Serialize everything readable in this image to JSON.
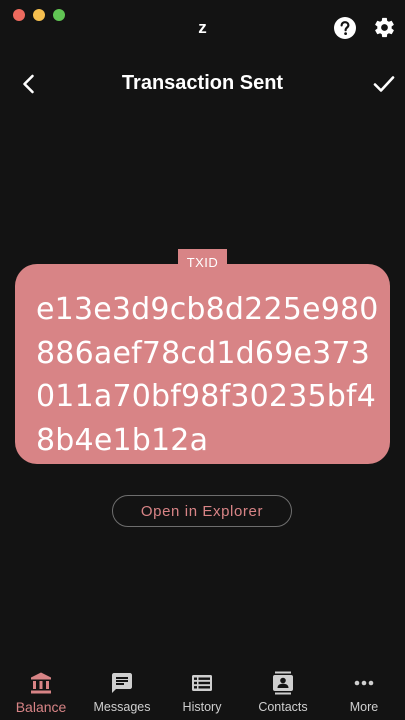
{
  "window": {
    "app_name": "z"
  },
  "header": {
    "title": "Transaction Sent"
  },
  "txid": {
    "badge_label": "TXID",
    "value": "e13e3d9cb8d225e980886aef78cd1d69e373011a70bf98f30235bf48b4e1b12a"
  },
  "actions": {
    "open_explorer_label": "Open in Explorer"
  },
  "tabs": [
    {
      "label": "Balance",
      "icon": "bank-icon",
      "active": true
    },
    {
      "label": "Messages",
      "icon": "message-icon",
      "active": false
    },
    {
      "label": "History",
      "icon": "list-icon",
      "active": false
    },
    {
      "label": "Contacts",
      "icon": "contacts-icon",
      "active": false
    },
    {
      "label": "More",
      "icon": "more-icon",
      "active": false
    }
  ],
  "colors": {
    "accent": "#d88486",
    "background": "#131313"
  }
}
